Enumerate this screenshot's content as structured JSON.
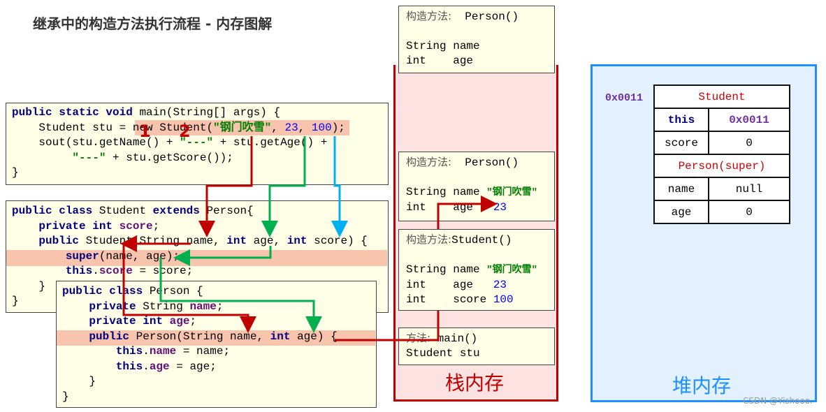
{
  "title": "继承中的构造方法执行流程 - 内存图解",
  "code": {
    "main": [
      [
        {
          "t": "public static void ",
          "c": "kw"
        },
        {
          "t": "main(String[] args) {",
          "c": ""
        }
      ],
      [
        {
          "t": "    Student stu = new Student(",
          "c": ""
        },
        {
          "t": "\"钢门吹雪\"",
          "c": "str"
        },
        {
          "t": ", ",
          "c": ""
        },
        {
          "t": "23",
          "c": "num"
        },
        {
          "t": ", ",
          "c": ""
        },
        {
          "t": "100",
          "c": "num"
        },
        {
          "t": ");",
          "c": ""
        }
      ],
      [
        {
          "t": "    sout(stu.getName() + ",
          "c": ""
        },
        {
          "t": "\"---\"",
          "c": "str"
        },
        {
          "t": " + stu.getAge() +",
          "c": ""
        }
      ],
      [
        {
          "t": "         ",
          "c": ""
        },
        {
          "t": "\"---\"",
          "c": "str"
        },
        {
          "t": " + stu.getScore());",
          "c": ""
        }
      ],
      [
        {
          "t": "}",
          "c": ""
        }
      ]
    ],
    "student": [
      [
        {
          "t": "public class ",
          "c": "kw"
        },
        {
          "t": "Student ",
          "c": ""
        },
        {
          "t": "extends ",
          "c": "kw"
        },
        {
          "t": "Person{",
          "c": ""
        }
      ],
      [
        {
          "t": "    private int ",
          "c": "kw"
        },
        {
          "t": "score",
          "c": "fld"
        },
        {
          "t": ";",
          "c": ""
        }
      ],
      [
        {
          "t": "    public ",
          "c": "kw"
        },
        {
          "t": "Student(String name, ",
          "c": ""
        },
        {
          "t": "int ",
          "c": "kw"
        },
        {
          "t": "age, ",
          "c": ""
        },
        {
          "t": "int ",
          "c": "kw"
        },
        {
          "t": "score) {",
          "c": ""
        }
      ],
      [
        {
          "t": "        super",
          "c": "kw"
        },
        {
          "t": "(name, age);",
          "c": ""
        }
      ],
      [
        {
          "t": "        this",
          "c": "kw"
        },
        {
          "t": ".",
          "c": ""
        },
        {
          "t": "score",
          "c": "fld"
        },
        {
          "t": " = score;",
          "c": ""
        }
      ],
      [
        {
          "t": "    }",
          "c": ""
        }
      ],
      [
        {
          "t": "}",
          "c": ""
        }
      ]
    ],
    "person": [
      [
        {
          "t": "public class ",
          "c": "kw"
        },
        {
          "t": "Person {",
          "c": ""
        }
      ],
      [
        {
          "t": "    private ",
          "c": "kw"
        },
        {
          "t": "String ",
          "c": ""
        },
        {
          "t": "name",
          "c": "fld"
        },
        {
          "t": ";",
          "c": ""
        }
      ],
      [
        {
          "t": "    private int ",
          "c": "kw"
        },
        {
          "t": "age",
          "c": "fld"
        },
        {
          "t": ";",
          "c": ""
        }
      ],
      [
        {
          "t": "    public ",
          "c": "kw"
        },
        {
          "t": "Person(String name, ",
          "c": ""
        },
        {
          "t": "int ",
          "c": "kw"
        },
        {
          "t": "age) {",
          "c": ""
        }
      ],
      [
        {
          "t": "        this",
          "c": "kw"
        },
        {
          "t": ".",
          "c": ""
        },
        {
          "t": "name",
          "c": "fld"
        },
        {
          "t": " = name;",
          "c": ""
        }
      ],
      [
        {
          "t": "        this",
          "c": "kw"
        },
        {
          "t": ".",
          "c": ""
        },
        {
          "t": "age",
          "c": "fld"
        },
        {
          "t": " = age;",
          "c": ""
        }
      ],
      [
        {
          "t": "    }",
          "c": ""
        }
      ],
      [
        {
          "t": "}",
          "c": ""
        }
      ]
    ]
  },
  "step_numbers": [
    "1",
    "2"
  ],
  "stack": {
    "label": "栈内存",
    "frames": {
      "person_top": {
        "head_cn": "构造方法:",
        "head": "  Person()",
        "l1": "String name",
        "l2": "int    age"
      },
      "person": {
        "head_cn": "构造方法:",
        "head": "  Person()",
        "l1": "String name ",
        "l1v": "\"钢门吹雪\"",
        "l2": "int    age   ",
        "l2v": "23"
      },
      "student": {
        "head_cn": "构造方法:",
        "head": "Student()",
        "l1": "String name ",
        "l1v": "\"钢门吹雪\"",
        "l2": "int    age   ",
        "l2v": "23",
        "l3": "int    score ",
        "l3v": "100"
      },
      "main": {
        "head_cn": "方法:",
        "head": " main()",
        "l1": "Student stu"
      }
    }
  },
  "heap": {
    "label": "堆内存",
    "address": "0x0011",
    "object": {
      "class": "Student",
      "this_label": "this",
      "this_value": "0x0011",
      "score_label": "score",
      "score_value": "0",
      "super": "Person(super)",
      "name_label": "name",
      "name_value": "null",
      "age_label": "age",
      "age_value": "0"
    }
  },
  "colors": {
    "stack": "#c00000",
    "heap": "#1e8fff",
    "arrow_red": "#c00000",
    "arrow_green": "#00b050",
    "arrow_blue": "#00b0f0"
  },
  "watermark": "CSDN @Yishooo."
}
